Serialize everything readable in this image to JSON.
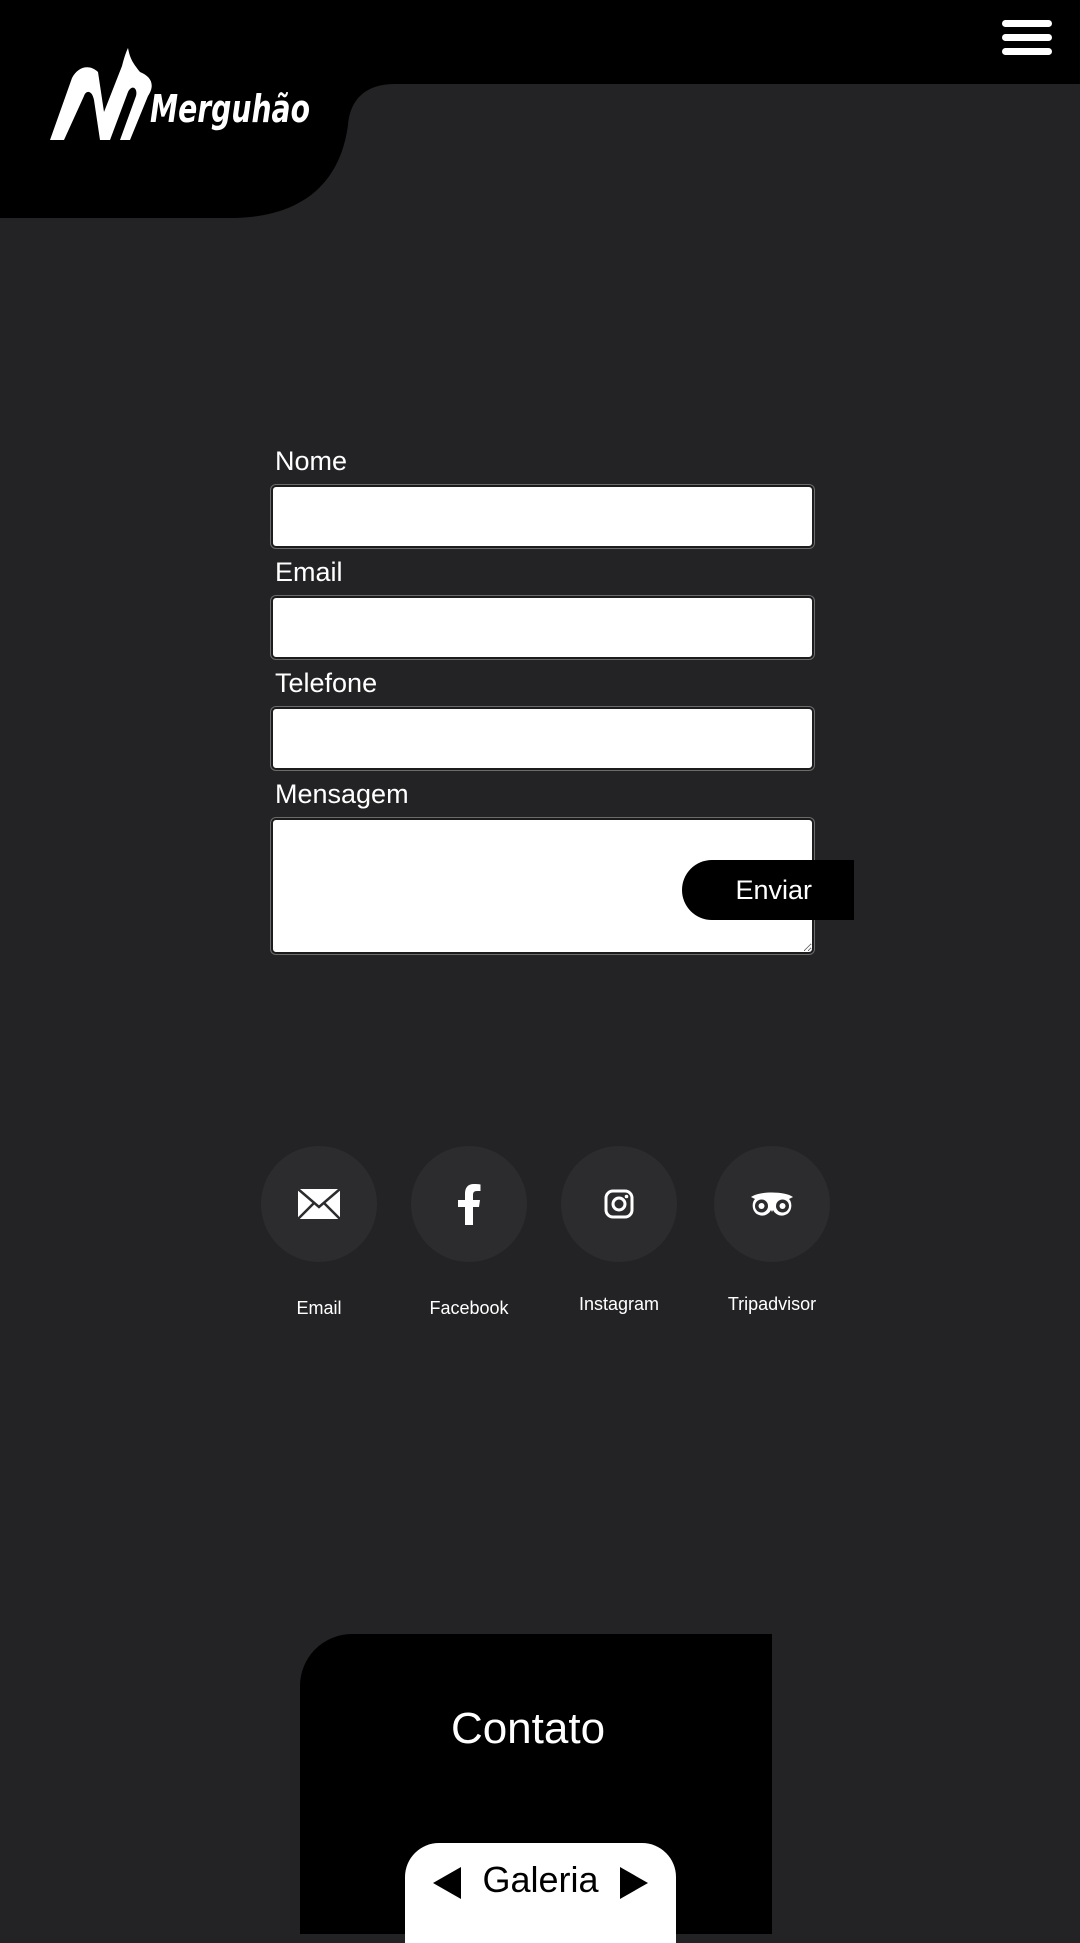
{
  "header": {
    "logo_text": "Merguhão",
    "menu_icon": "hamburger-icon"
  },
  "form": {
    "name_label": "Nome",
    "name_value": "",
    "email_label": "Email",
    "email_value": "",
    "phone_label": "Telefone",
    "phone_value": "",
    "message_label": "Mensagem",
    "message_value": "",
    "send_label": "Enviar"
  },
  "socials": [
    {
      "label": "Email",
      "icon": "envelope-icon"
    },
    {
      "label": "Facebook",
      "icon": "facebook-icon"
    },
    {
      "label": "Instagram",
      "icon": "instagram-icon"
    },
    {
      "label": "Tripadvisor",
      "icon": "tripadvisor-icon"
    }
  ],
  "footer": {
    "contact_title": "Contato",
    "gallery_label": "Galeria",
    "prev_icon": "triangle-left-icon",
    "next_icon": "triangle-right-icon"
  },
  "colors": {
    "background": "#232325",
    "header": "#000000",
    "social_circle": "#2c2c2e",
    "text": "#ffffff"
  }
}
